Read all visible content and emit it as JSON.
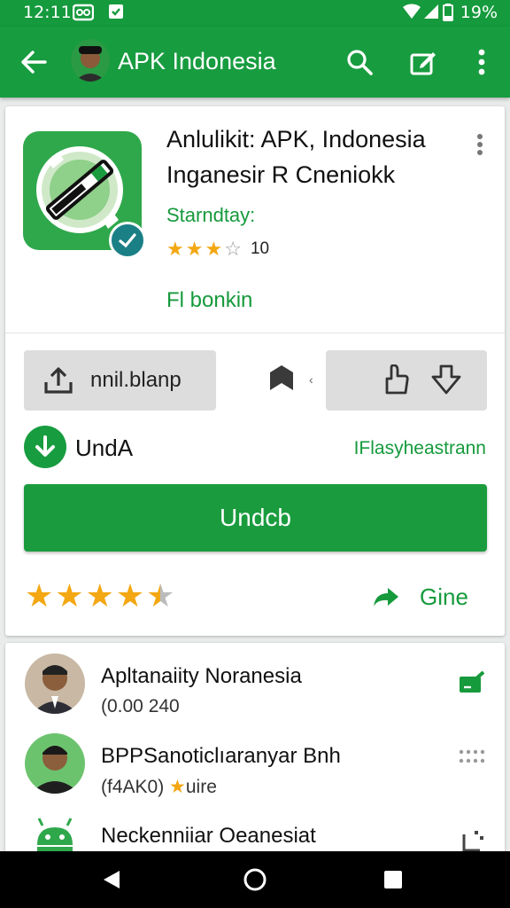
{
  "status_bar": {
    "time": "12:11",
    "battery": "19%"
  },
  "app_bar": {
    "title": "APK Indonesia"
  },
  "app": {
    "name": "Anlulikit: APK, Indonesia",
    "developer": "Inganesir R Cneniokk",
    "status": "Starndtay:",
    "rating_stars": 3,
    "rating_count": "10",
    "link": "Fl bonkin"
  },
  "actions": {
    "share_label": "nnil.blanp",
    "download_heading": "UndA",
    "download_meta": "IFlasyheastrann",
    "download_button": "Undcb",
    "overall_rating": 4.5,
    "share_text": "Gine"
  },
  "related": [
    {
      "name": "Apltanaiity Noranesia",
      "sub": "(0.00 240"
    },
    {
      "name": "BPPSanoticlıaranyar Bnh",
      "sub_prefix": "(f4AK0)",
      "sub_suffix": "uire"
    },
    {
      "name": "Neckenniiar Oeanesiat",
      "sub": ""
    }
  ],
  "colors": {
    "brand_green": "#179c3f",
    "star": "#f3a712"
  }
}
